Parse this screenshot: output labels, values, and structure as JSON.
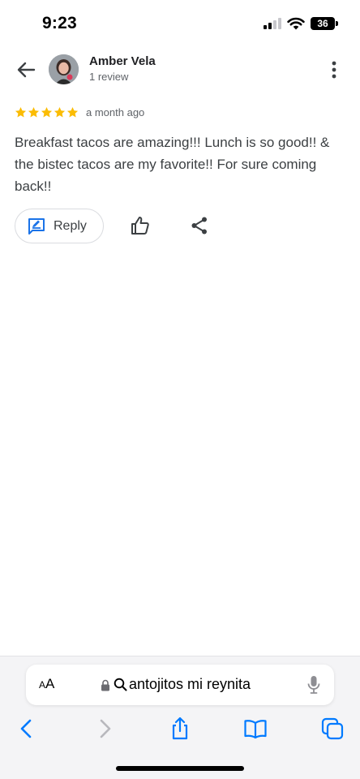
{
  "status_bar": {
    "time": "9:23",
    "battery": "36",
    "icons": [
      "signal-icon",
      "wifi-icon",
      "battery-icon"
    ]
  },
  "header": {
    "back_icon": "arrow-left-icon",
    "reviewer_name": "Amber Vela",
    "reviewer_review_count": "1 review",
    "menu_icon": "more-vertical-icon"
  },
  "review": {
    "rating": 5,
    "max_rating": 5,
    "date": "a month ago",
    "text": "Breakfast tacos are amazing!!! Lunch is so good!! & the bistec tacos are my favorite!! For sure coming back!!"
  },
  "actions": {
    "reply_label": "Reply",
    "reply_icon": "reply-icon",
    "like_icon": "thumbs-up-icon",
    "share_icon": "share-icon"
  },
  "browser": {
    "text_size_label_small": "A",
    "text_size_label_large": "A",
    "url": "antojitos mi reynita",
    "icons": [
      "lock-icon",
      "search-icon",
      "microphone-icon",
      "back-icon",
      "forward-icon",
      "share-icon",
      "bookmarks-icon",
      "tabs-icon"
    ]
  },
  "colors": {
    "star": "#fbbc04",
    "accent_blue": "#1a73e8",
    "safari_blue": "#007aff",
    "text_primary": "#202124",
    "text_secondary": "#5f6368"
  }
}
